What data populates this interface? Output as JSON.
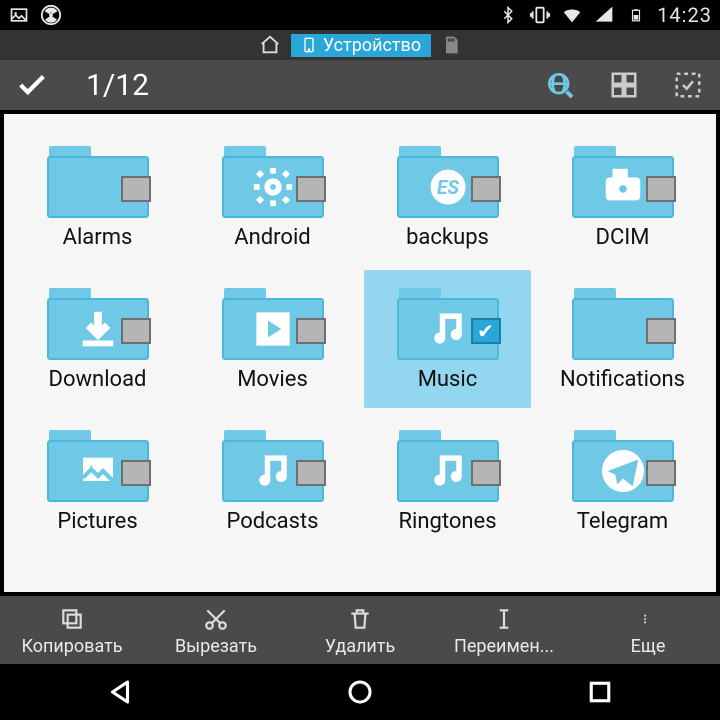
{
  "statusbar": {
    "time": "14:23"
  },
  "pathbar": {
    "location": "Устройство"
  },
  "toolbar": {
    "selection_count": "1/12"
  },
  "folders": [
    {
      "name": "Alarms",
      "icon": "none",
      "selected": false
    },
    {
      "name": "Android",
      "icon": "gear",
      "selected": false
    },
    {
      "name": "backups",
      "icon": "es",
      "selected": false
    },
    {
      "name": "DCIM",
      "icon": "camera",
      "selected": false
    },
    {
      "name": "Download",
      "icon": "download",
      "selected": false
    },
    {
      "name": "Movies",
      "icon": "play",
      "selected": false
    },
    {
      "name": "Music",
      "icon": "music",
      "selected": true
    },
    {
      "name": "Notifications",
      "icon": "none",
      "selected": false
    },
    {
      "name": "Pictures",
      "icon": "picture",
      "selected": false
    },
    {
      "name": "Podcasts",
      "icon": "music",
      "selected": false
    },
    {
      "name": "Ringtones",
      "icon": "music",
      "selected": false
    },
    {
      "name": "Telegram",
      "icon": "telegram",
      "selected": false
    }
  ],
  "actions": {
    "copy": "Копировать",
    "cut": "Вырезать",
    "delete": "Удалить",
    "rename": "Переимен...",
    "more": "Еще"
  }
}
